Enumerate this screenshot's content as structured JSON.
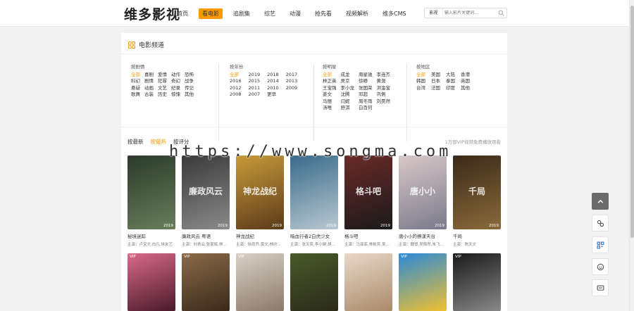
{
  "site": {
    "logo": "维多影视"
  },
  "nav": [
    {
      "label": "首页",
      "active": false
    },
    {
      "label": "看电影",
      "active": true
    },
    {
      "label": "追剧集",
      "active": false
    },
    {
      "label": "综艺",
      "active": false
    },
    {
      "label": "动漫",
      "active": false
    },
    {
      "label": "抢先看",
      "active": false
    },
    {
      "label": "视频解析",
      "active": false
    },
    {
      "label": "维多CMS",
      "active": false
    }
  ],
  "search": {
    "type": "影视",
    "placeholder": "输入影片关键词..."
  },
  "panel": {
    "title": "电影频道"
  },
  "filters": {
    "genre": {
      "head": "按剧情",
      "items": [
        "全部",
        "喜剧",
        "爱情",
        "动作",
        "恐怖",
        "科幻",
        "剧情",
        "犯罪",
        "奇幻",
        "战争",
        "悬疑",
        "动画",
        "文艺",
        "纪录",
        "传记",
        "歌舞",
        "古装",
        "历史",
        "惊悚",
        "其他"
      ]
    },
    "year": {
      "head": "按年份",
      "items": [
        "全部",
        "2019",
        "2018",
        "2017",
        "2016",
        "2015",
        "2014",
        "2013",
        "2012",
        "2011",
        "2010",
        "2009",
        "2008",
        "2007",
        "更早"
      ]
    },
    "actor": {
      "head": "按明星",
      "items": [
        "全部",
        "成龙",
        "周星驰",
        "李连杰",
        "林正英",
        "吴京",
        "徐峥",
        "黄渤",
        "王宝强",
        "李小龙",
        "张国荣",
        "洪金宝",
        "姜文",
        "沈腾",
        "邓超",
        "巩俐",
        "马丽",
        "闫妮",
        "周冬雨",
        "刘昊然",
        "汤唯",
        "舒淇",
        "白百何"
      ]
    },
    "region": {
      "head": "按地区",
      "items": [
        "全部",
        "美国",
        "大陆",
        "香港",
        "韩国",
        "日本",
        "泰国",
        "英国",
        "台湾",
        "法国",
        "印度",
        "其他"
      ]
    }
  },
  "sort": [
    {
      "label": "按最新",
      "on": false
    },
    {
      "label": "按最热",
      "on": true
    },
    {
      "label": "按评分",
      "on": false
    }
  ],
  "vip_note": "1万部VIP视频免费播放观看",
  "watermark": "https://www.songma.com",
  "movies": [
    {
      "title": "秘境迷踪",
      "cast": "主演：卢宝文,白凡,徐友艺",
      "year": "2019",
      "color1": "#2b3a2c",
      "color2": "#6a7d5a",
      "poster_text": ""
    },
    {
      "title": "廉政风云 粤语",
      "cast": "主演：刘青云,张家辉,林…",
      "year": "2019",
      "color1": "#3a3a3a",
      "color2": "#8a8a8a",
      "poster_text": "廉政风云"
    },
    {
      "title": "神龙战纪",
      "cast": "主演：徐雨乔,黄文,林欣…",
      "year": "2019",
      "color1": "#c89a3a",
      "color2": "#5a3a1a",
      "poster_text": "神龙战纪"
    },
    {
      "title": "暗血行者2白虎少女",
      "cast": "主演：张天奕,李小婉,胡…",
      "year": "2019",
      "color1": "#3a6a8a",
      "color2": "#b8c8d0",
      "poster_text": ""
    },
    {
      "title": "格斗吧",
      "cast": "主演：马菲菲,林彬芳,吴…",
      "year": "2019",
      "color1": "#6a2a2a",
      "color2": "#1a1a1a",
      "poster_text": "格斗吧"
    },
    {
      "title": "唐小小的撩漾天台",
      "cast": "主演：魏贤,吴佩然,朱飞…",
      "year": "2019",
      "color1": "#d8c8c8",
      "color2": "#7a7a8a",
      "poster_text": "唐小小"
    },
    {
      "title": "千局",
      "cast": "主演：陈天文",
      "year": "2019",
      "color1": "#3a2a1a",
      "color2": "#8a6a3a",
      "poster_text": "千局"
    }
  ],
  "movies_row2": [
    {
      "vip": "VIP",
      "color1": "#d86a8a",
      "color2": "#4a1a2a"
    },
    {
      "vip": "VIP",
      "color1": "#8a6a4a",
      "color2": "#3a2a1a"
    },
    {
      "vip": "VIP",
      "color1": "#d8d0c8",
      "color2": "#8a7a6a"
    },
    {
      "vip": "",
      "color1": "#4a5a2a",
      "color2": "#2a2a1a"
    },
    {
      "vip": "",
      "color1": "#e8d8c8",
      "color2": "#aa8a6a"
    },
    {
      "vip": "VIP",
      "color1": "#2a8ad8",
      "color2": "#f0c030"
    },
    {
      "vip": "VIP",
      "color1": "#1a1a1a",
      "color2": "#888888"
    }
  ]
}
